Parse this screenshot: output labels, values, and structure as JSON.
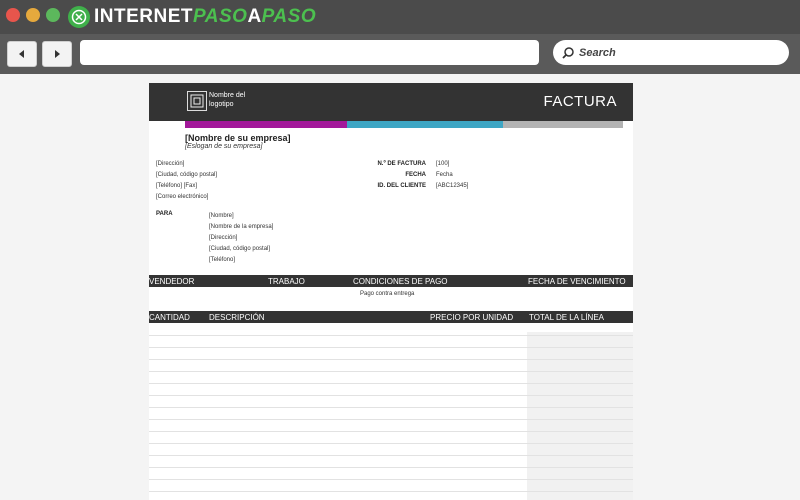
{
  "window": {
    "brand": {
      "part1": "INTERNET",
      "part2": "PASO",
      "part3": "A",
      "part4": "PASO"
    }
  },
  "nav": {
    "search_placeholder": "Search"
  },
  "invoice": {
    "logo_label": "Nombre del logotipo",
    "title": "FACTURA",
    "company_name": "[Nombre de su empresa]",
    "company_slogan": "[Eslogan de su empresa]",
    "address_lines": [
      "[Dirección]",
      "[Ciudad, código postal]",
      "[Teléfono] [Fax]",
      "[Correo electrónico]"
    ],
    "meta": [
      {
        "label": "N.º DE FACTURA",
        "value": "[100]"
      },
      {
        "label": "FECHA",
        "value": "Fecha"
      },
      {
        "label": "ID. DEL CLIENTE",
        "value": "[ABC12345]"
      }
    ],
    "para_label": "PARA",
    "para_lines": [
      "[Nombre]",
      "[Nombre de la empresa]",
      "[Dirección]",
      "[Ciudad, código postal]",
      "[Teléfono]"
    ],
    "terms_headers": [
      "VENDEDOR",
      "TRABAJO",
      "CONDICIONES DE PAGO",
      "FECHA DE VENCIMIENTO"
    ],
    "terms_value": "Pago contra entrega",
    "items_headers": [
      "CANTIDAD",
      "DESCRIPCIÓN",
      "PRECIO POR UNIDAD",
      "TOTAL DE LA LÍNEA"
    ]
  }
}
